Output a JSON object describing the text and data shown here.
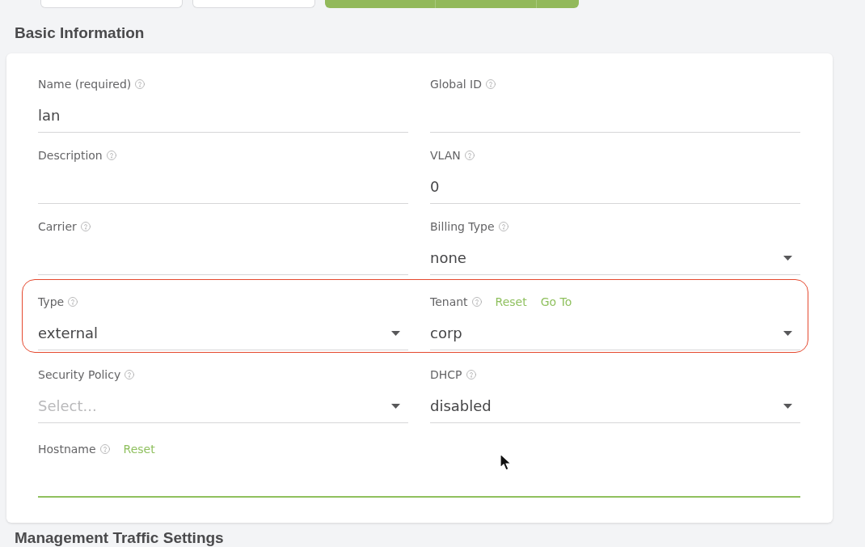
{
  "toolbar": [
    {
      "kind": "outline"
    },
    {
      "kind": "outline"
    },
    {
      "kind": "primary"
    },
    {
      "kind": "primary"
    },
    {
      "kind": "primary"
    }
  ],
  "section": {
    "title": "Basic Information"
  },
  "rows": [
    {
      "highlighted": false,
      "fields": [
        {
          "label": "Name (required)",
          "kind": "text",
          "value": "lan",
          "focused": false
        },
        {
          "label": "Global ID",
          "kind": "text",
          "focused": false
        }
      ]
    },
    {
      "highlighted": false,
      "fields": [
        {
          "label": "Description",
          "kind": "text",
          "focused": false
        },
        {
          "label": "VLAN",
          "kind": "text",
          "value": "0",
          "focused": false
        }
      ]
    },
    {
      "highlighted": false,
      "fields": [
        {
          "label": "Carrier",
          "kind": "text",
          "focused": false
        },
        {
          "label": "Billing Type",
          "kind": "select",
          "value": "none",
          "focused": false
        }
      ]
    },
    {
      "highlighted": true,
      "fields": [
        {
          "label": "Type",
          "kind": "select",
          "value": "external",
          "focused": false
        },
        {
          "label": "Tenant",
          "kind": "select",
          "value": "corp",
          "links": [
            "Reset",
            "Go To"
          ],
          "focused": false
        }
      ]
    },
    {
      "highlighted": false,
      "fields": [
        {
          "label": "Security Policy",
          "kind": "select",
          "placeholder": "Select...",
          "focused": false
        },
        {
          "label": "DHCP",
          "kind": "select",
          "value": "disabled",
          "focused": false
        }
      ]
    },
    {
      "highlighted": false,
      "fields": [
        {
          "label": "Hostname",
          "kind": "text",
          "links": [
            "Reset"
          ],
          "focused": true
        }
      ]
    }
  ],
  "next_section": {
    "title": "Management Traffic Settings"
  }
}
